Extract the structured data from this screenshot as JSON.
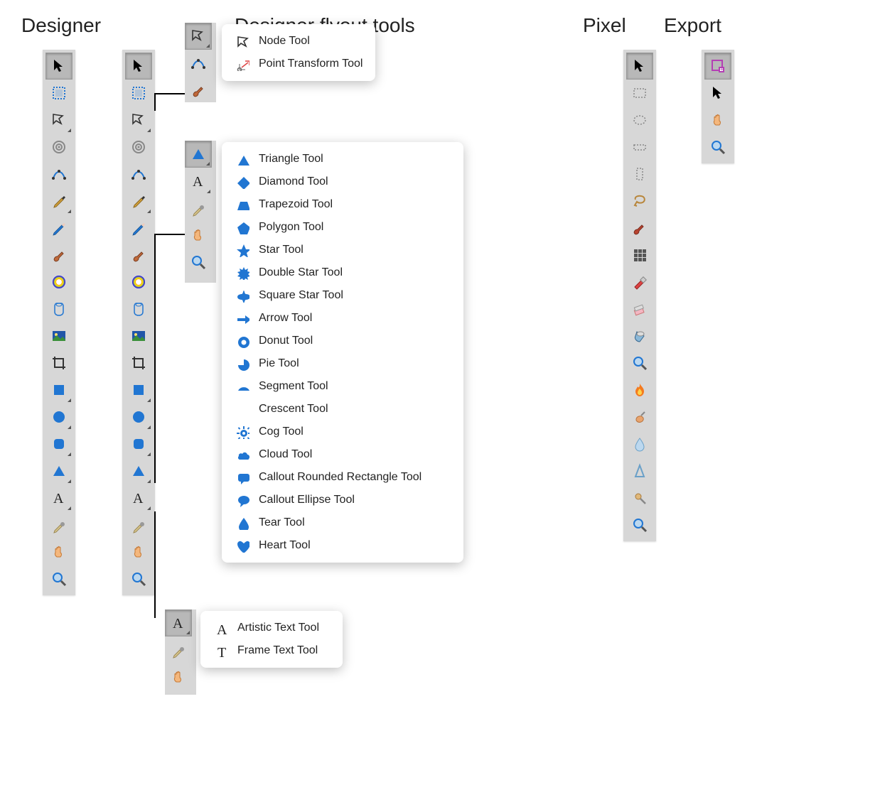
{
  "labels": {
    "designer": "Designer",
    "flyout": "Designer flyout tools",
    "pixel": "Pixel",
    "export": "Export"
  },
  "flyouts": {
    "node": [
      {
        "name": "Node Tool",
        "icon": "node"
      },
      {
        "name": "Point Transform Tool",
        "icon": "point-transform"
      }
    ],
    "shape": [
      {
        "name": "Triangle Tool",
        "icon": "triangle"
      },
      {
        "name": "Diamond Tool",
        "icon": "diamond"
      },
      {
        "name": "Trapezoid Tool",
        "icon": "trapezoid"
      },
      {
        "name": "Polygon Tool",
        "icon": "polygon"
      },
      {
        "name": "Star Tool",
        "icon": "star"
      },
      {
        "name": "Double Star Tool",
        "icon": "double-star"
      },
      {
        "name": "Square Star Tool",
        "icon": "square-star"
      },
      {
        "name": "Arrow Tool",
        "icon": "arrow"
      },
      {
        "name": "Donut Tool",
        "icon": "donut"
      },
      {
        "name": "Pie Tool",
        "icon": "pie"
      },
      {
        "name": "Segment Tool",
        "icon": "segment"
      },
      {
        "name": "Crescent Tool",
        "icon": "crescent"
      },
      {
        "name": "Cog Tool",
        "icon": "cog"
      },
      {
        "name": "Cloud Tool",
        "icon": "cloud"
      },
      {
        "name": "Callout Rounded Rectangle Tool",
        "icon": "callout-rect"
      },
      {
        "name": "Callout Ellipse Tool",
        "icon": "callout-ellipse"
      },
      {
        "name": "Tear Tool",
        "icon": "tear"
      },
      {
        "name": "Heart Tool",
        "icon": "heart"
      }
    ],
    "text": [
      {
        "name": "Artistic Text Tool",
        "icon": "artistic-text"
      },
      {
        "name": "Frame Text Tool",
        "icon": "frame-text"
      }
    ]
  },
  "toolbars": {
    "designer": [
      "move",
      "artboard",
      "node",
      "corner",
      "vector",
      "pen",
      "pencil",
      "brush",
      "colorpick",
      "glass",
      "picture",
      "crop",
      "square",
      "circle",
      "roundrect",
      "triangle",
      "text",
      "eyedrop",
      "hand",
      "zoom"
    ],
    "pixel": [
      "move",
      "marquee-rect",
      "marquee-ellipse",
      "marquee-free",
      "marquee-col",
      "lasso",
      "brush2",
      "grid",
      "paint",
      "erase",
      "bucket",
      "zoom",
      "flame",
      "smudge",
      "drop",
      "sharpen",
      "clone",
      "zoom"
    ],
    "export": [
      "slice",
      "move",
      "hand",
      "zoom"
    ]
  }
}
